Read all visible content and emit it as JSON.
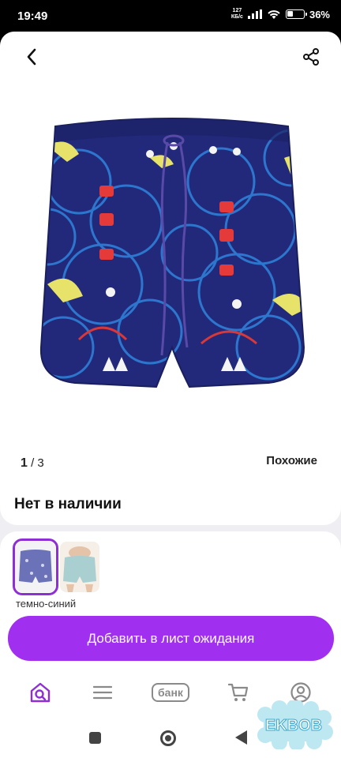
{
  "status_bar": {
    "time": "19:49",
    "net_speed_value": "127",
    "net_speed_unit": "КБ/с",
    "battery_percent": 36,
    "battery_label": "36%"
  },
  "header": {
    "back_icon": "chevron-left-icon",
    "share_icon": "share-icon"
  },
  "gallery": {
    "current": "1",
    "separator": "/",
    "total": "3",
    "similar_label": "Похожие"
  },
  "availability": "Нет в наличии",
  "variants": {
    "selected_color_name": "темно-синий",
    "colors": [
      "#1f2a7a",
      "#a9cfd0"
    ]
  },
  "cta": {
    "label": "Добавить в лист ожидания",
    "color": "#a02ff0"
  },
  "bottom_nav": {
    "home_icon": "home-search-icon",
    "catalog_icon": "menu-icon",
    "bank_label": "банк",
    "cart_icon": "cart-icon",
    "profile_icon": "profile-icon",
    "accent_color": "#8e2fd6"
  },
  "watermark": {
    "text": "EKBOB"
  }
}
